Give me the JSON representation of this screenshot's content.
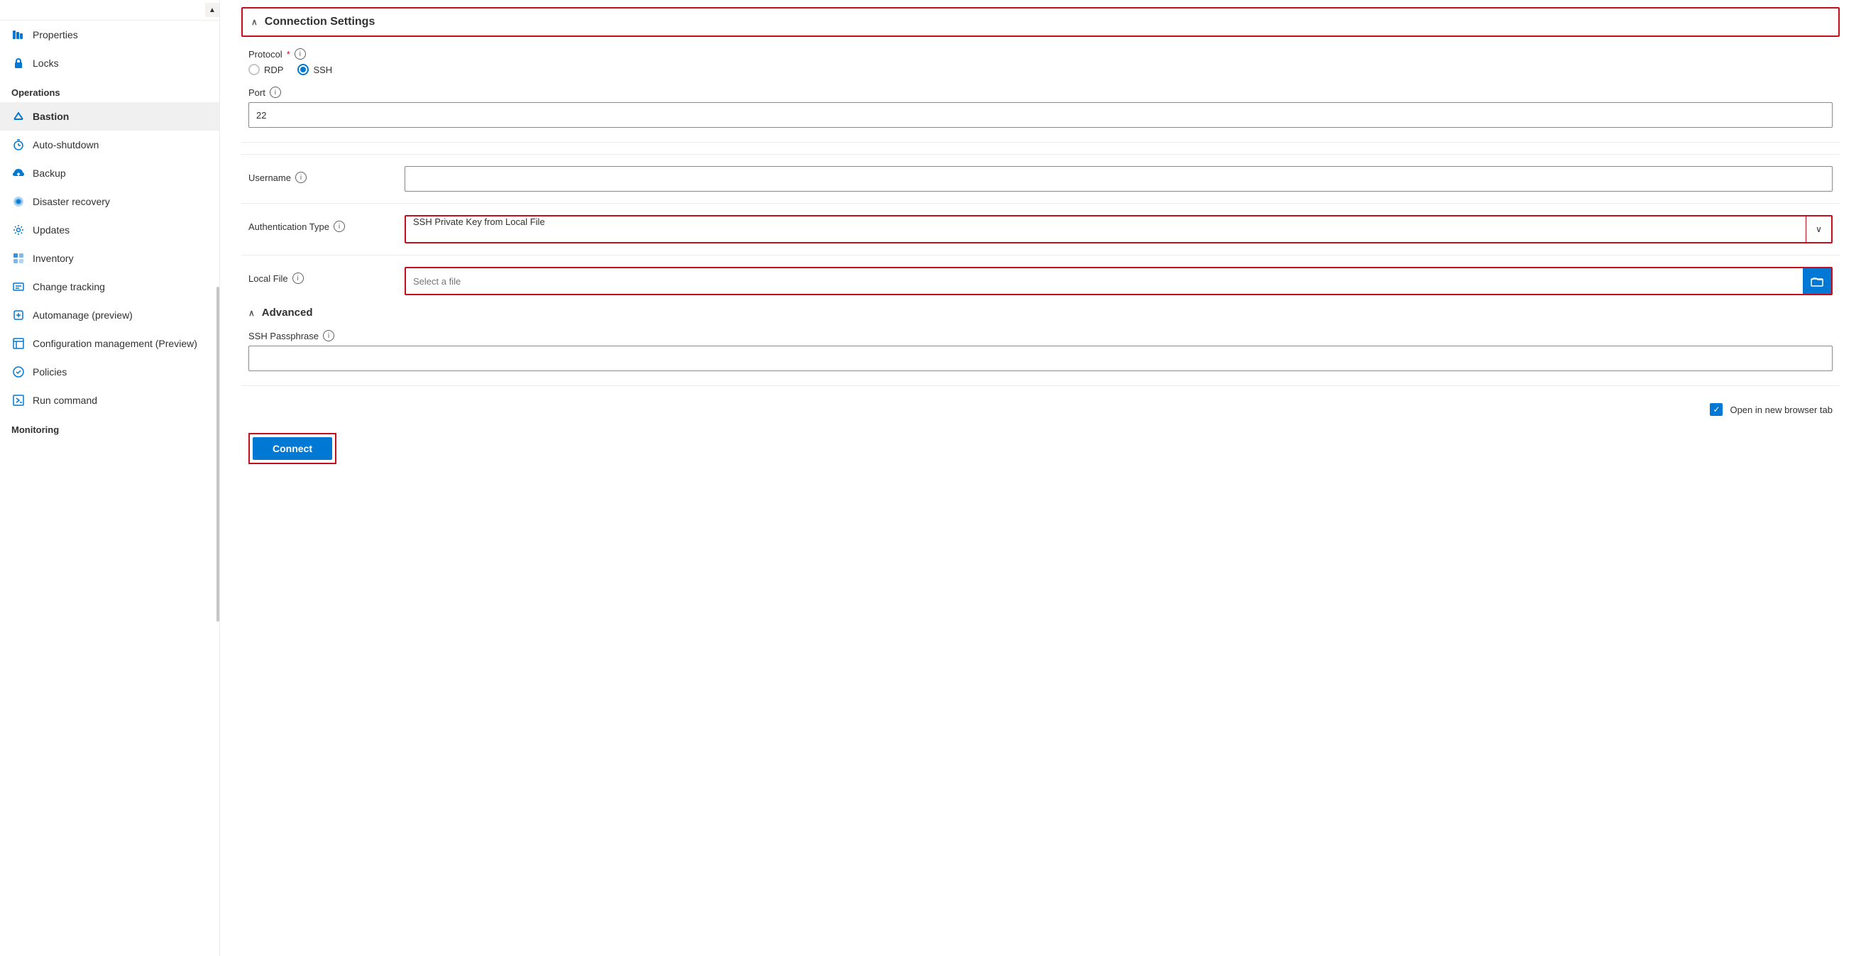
{
  "sidebar": {
    "items": [
      {
        "id": "properties",
        "label": "Properties",
        "icon": "bars-icon",
        "section": null,
        "active": false
      },
      {
        "id": "locks",
        "label": "Locks",
        "icon": "lock-icon",
        "section": null,
        "active": false
      },
      {
        "id": "operations-title",
        "label": "Operations",
        "isTitle": true
      },
      {
        "id": "bastion",
        "label": "Bastion",
        "icon": "bastion-icon",
        "section": "operations",
        "active": true
      },
      {
        "id": "auto-shutdown",
        "label": "Auto-shutdown",
        "icon": "clock-icon",
        "section": "operations",
        "active": false
      },
      {
        "id": "backup",
        "label": "Backup",
        "icon": "backup-icon",
        "section": "operations",
        "active": false
      },
      {
        "id": "disaster-recovery",
        "label": "Disaster recovery",
        "icon": "disaster-icon",
        "section": "operations",
        "active": false
      },
      {
        "id": "updates",
        "label": "Updates",
        "icon": "gear-icon",
        "section": "operations",
        "active": false
      },
      {
        "id": "inventory",
        "label": "Inventory",
        "icon": "inventory-icon",
        "section": "operations",
        "active": false
      },
      {
        "id": "change-tracking",
        "label": "Change tracking",
        "icon": "change-icon",
        "section": "operations",
        "active": false
      },
      {
        "id": "automanage",
        "label": "Automanage (preview)",
        "icon": "automanage-icon",
        "section": "operations",
        "active": false
      },
      {
        "id": "config-management",
        "label": "Configuration management (Preview)",
        "icon": "config-icon",
        "section": "operations",
        "active": false
      },
      {
        "id": "policies",
        "label": "Policies",
        "icon": "policies-icon",
        "section": "operations",
        "active": false
      },
      {
        "id": "run-command",
        "label": "Run command",
        "icon": "run-icon",
        "section": "operations",
        "active": false
      },
      {
        "id": "monitoring-title",
        "label": "Monitoring",
        "isTitle": true
      }
    ]
  },
  "main": {
    "connection_settings_label": "Connection Settings",
    "protocol_label": "Protocol",
    "rdp_label": "RDP",
    "ssh_label": "SSH",
    "port_label": "Port",
    "port_value": "22",
    "username_label": "Username",
    "username_placeholder": "",
    "auth_type_label": "Authentication Type",
    "auth_type_value": "SSH Private Key from Local File",
    "local_file_label": "Local File",
    "local_file_placeholder": "Select a file",
    "advanced_label": "Advanced",
    "ssh_passphrase_label": "SSH Passphrase",
    "ssh_passphrase_value": "",
    "open_new_tab_label": "Open in new browser tab",
    "connect_label": "Connect",
    "chevron_up": "∧",
    "chevron_down": "∨",
    "info_symbol": "i",
    "check_symbol": "✓"
  }
}
